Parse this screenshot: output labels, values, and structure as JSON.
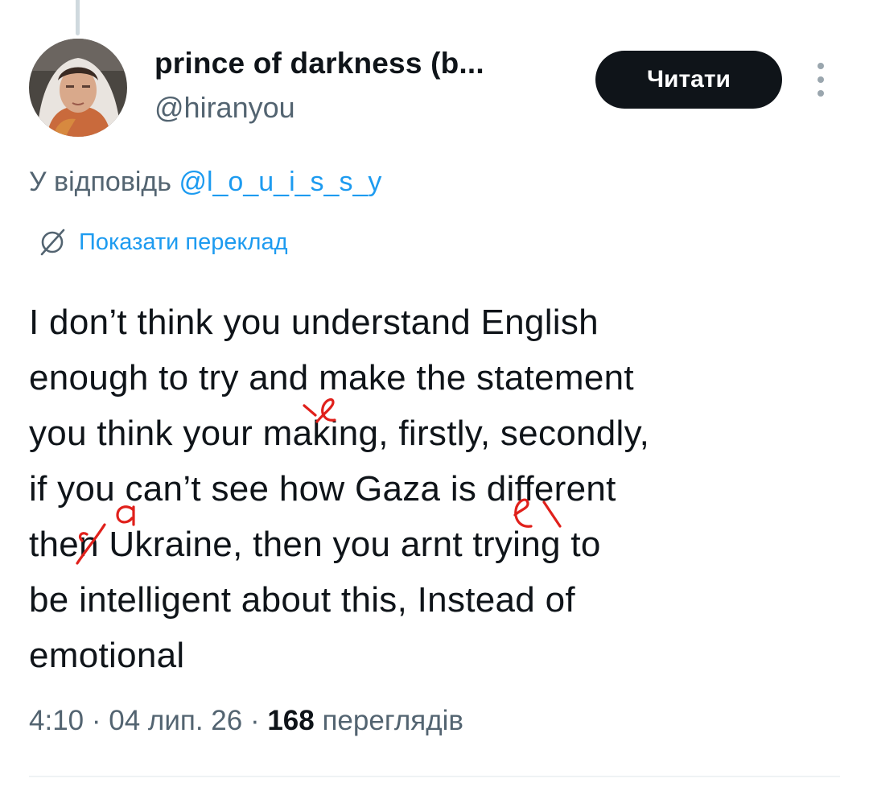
{
  "tweet": {
    "author": {
      "display_name": "prince of darkness (b...",
      "handle": "@hiranyou",
      "avatar": "avatar-photo"
    },
    "follow_label": "Читати",
    "more_icon": "more-vertical-icon",
    "reply_prefix": "У відповідь",
    "reply_mention": "@l_o_u_i_s_s_y",
    "translate_icon": "globe-slash-icon",
    "translate_label": "Показати переклад",
    "text": "I don’t think you understand English\nenough to try and make the statement\nyou think your making, firstly, secondly,\nif you can’t see how Gaza is different\nthen Ukraine, then you arnt trying to\nbe intelligent about this, Instead of\nemotional",
    "time": "4:10",
    "separator": "·",
    "date": "04 лип. 26",
    "views_count": "168",
    "views_label": "переглядів"
  },
  "handwritten_corrections": [
    "e",
    "a",
    "e",
    "a"
  ],
  "colors": {
    "text": "#0f1419",
    "muted": "#536471",
    "link": "#1d9bf0",
    "button": "#0f1419",
    "annotation": "#e0201b"
  }
}
